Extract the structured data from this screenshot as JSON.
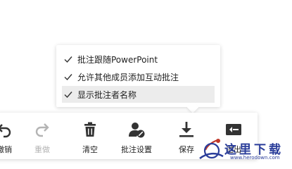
{
  "comment_menu": {
    "items": [
      {
        "label": "批注跟随PowerPoint",
        "checked": true,
        "highlighted": false
      },
      {
        "label": "允许其他成员添加互动批注",
        "checked": true,
        "highlighted": false
      },
      {
        "label": "显示批注者名称",
        "checked": true,
        "highlighted": true
      }
    ]
  },
  "toolbar": {
    "undo_label": "撤销",
    "redo_label": "重做",
    "clear_label": "清空",
    "comment_settings_label": "批注设置",
    "save_label": "保存",
    "exit_label": "退出"
  },
  "watermark": {
    "text": "这里下载",
    "url": "www.herodown.com"
  },
  "colors": {
    "icon": "#333333",
    "disabled": "#b4b4b4",
    "highlight": "#ececec",
    "watermark": "#2a3d9a"
  }
}
